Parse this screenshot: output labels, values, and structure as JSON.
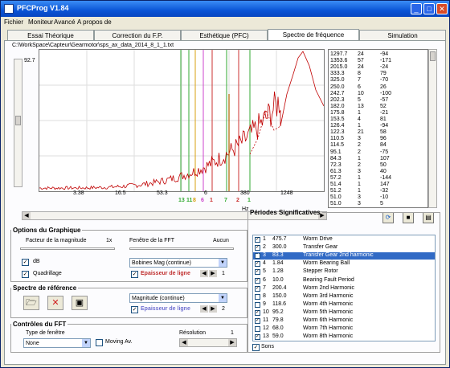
{
  "window": {
    "title": "PFCProg V1.84"
  },
  "menu": [
    "Fichier",
    "Moniteur",
    "Avancé",
    "A propos de"
  ],
  "tabs": [
    {
      "label": "Essai Théorique",
      "active": false
    },
    {
      "label": "Correction du F.P.",
      "active": false
    },
    {
      "label": "Esthétique (PFC)",
      "active": false
    },
    {
      "label": "Spectre de fréquence",
      "active": true
    },
    {
      "label": "Simulation",
      "active": false
    }
  ],
  "chart": {
    "path": "C:\\WorkSpace\\Capteur\\Gearmotor\\sps_ax_data_2014_8_1_1.txt",
    "ytop": "92.7",
    "xticks": [
      "3.38",
      "16.5",
      "53.3",
      "6",
      "380",
      "1248"
    ],
    "xunit": "Hz",
    "markers": [
      {
        "label": "13",
        "color": "#33aa33"
      },
      {
        "label": "11",
        "color": "#33aa33"
      },
      {
        "label": "8",
        "color": "#d8a010"
      },
      {
        "label": "6",
        "color": "#cc44cc"
      },
      {
        "label": "1",
        "color": "#cc3333"
      },
      {
        "label": "7",
        "color": "#33aa33"
      },
      {
        "label": "2",
        "color": "#cc3333"
      },
      {
        "label": "1",
        "color": "#33aa33"
      }
    ]
  },
  "freq_list": [
    [
      "1297.7",
      "24",
      "-94"
    ],
    [
      "1353.6",
      "57",
      "-171"
    ],
    [
      "2015.0",
      "24",
      "-24"
    ],
    [
      "333.3",
      "8",
      "79"
    ],
    [
      "325.0",
      "7",
      "-70"
    ],
    [
      "250.0",
      "6",
      "26"
    ],
    [
      "242.7",
      "10",
      "-100"
    ],
    [
      "202.3",
      "5",
      "-57"
    ],
    [
      "182.0",
      "13",
      "52"
    ],
    [
      "175.8",
      "1",
      "-21"
    ],
    [
      "153.5",
      "4",
      "81"
    ],
    [
      "126.4",
      "1",
      "-94"
    ],
    [
      "122.3",
      "21",
      "58"
    ],
    [
      "110.5",
      "3",
      "96"
    ],
    [
      "114.5",
      "2",
      "84"
    ],
    [
      "95.1",
      "2",
      "-75"
    ],
    [
      "84.3",
      "1",
      "107"
    ],
    [
      "72.3",
      "2",
      "50"
    ],
    [
      "61.3",
      "3",
      "40"
    ],
    [
      "57.2",
      "1",
      "-144"
    ],
    [
      "51.4",
      "1",
      "147"
    ],
    [
      "51.2",
      "1",
      "-32"
    ],
    [
      "51.0",
      "3",
      "-10"
    ],
    [
      "51.0",
      "3",
      "5"
    ]
  ],
  "options": {
    "legend": "Options du Graphique",
    "scale_label": "Facteur de la magnitude",
    "scale_value": "1x",
    "fft_label": "Fenêtre de la FFT",
    "fft_value": "Aucun",
    "db_label": "dB",
    "quadrillage_label": "Quadrillage",
    "db_checked": true,
    "quadrillage_checked": true,
    "plot_combo": "Bobines Mag (continue)",
    "epaisseur_label": "Epaisseur de ligne",
    "epaisseur_value": "1"
  },
  "reference": {
    "legend": "Spectre de référence",
    "combo": "Magnitude (continue)",
    "epaisseur_label": "Epaisseur de ligne",
    "epaisseur_value": "2"
  },
  "fft_controls": {
    "legend": "Contrôles du FFT",
    "type_label": "Type de fenêtre",
    "type_value": "None",
    "moving_avg_label": "Moving Av.",
    "resolution_label": "Résolution",
    "resolution_value": "1"
  },
  "periods": {
    "legend": "Périodes Significatives",
    "rows": [
      {
        "num": "1",
        "val": "475.7",
        "name": "Worm Drive",
        "checked": true,
        "selected": false
      },
      {
        "num": "2",
        "val": "300.0",
        "name": "Transfer Gear",
        "checked": true,
        "selected": false
      },
      {
        "num": "3",
        "val": "83.3",
        "name": "Transfer Gear 2nd harmonic",
        "checked": true,
        "selected": true
      },
      {
        "num": "4",
        "val": "1.84",
        "name": "Worm Bearing Ball",
        "checked": true,
        "selected": false
      },
      {
        "num": "5",
        "val": "1.28",
        "name": "Stepper Rotor",
        "checked": true,
        "selected": false
      },
      {
        "num": "6",
        "val": "10.0",
        "name": "Bearing Fault Period",
        "checked": true,
        "selected": false
      },
      {
        "num": "7",
        "val": "200.4",
        "name": "Worm 2nd Harmonic",
        "checked": true,
        "selected": false
      },
      {
        "num": "8",
        "val": "150.0",
        "name": "Worm 3rd Harmonic",
        "checked": false,
        "selected": false
      },
      {
        "num": "9",
        "val": "118.6",
        "name": "Worm 4th Harmonic",
        "checked": false,
        "selected": false
      },
      {
        "num": "10",
        "val": "95.2",
        "name": "Worm 5th Harmonic",
        "checked": true,
        "selected": false
      },
      {
        "num": "11",
        "val": "79.8",
        "name": "Worm 6th Harmonic",
        "checked": true,
        "selected": false
      },
      {
        "num": "12",
        "val": "68.0",
        "name": "Worm 7th Harmonic",
        "checked": false,
        "selected": false
      },
      {
        "num": "13",
        "val": "59.0",
        "name": "Worm 8th Harmonic",
        "checked": true,
        "selected": false
      }
    ],
    "bottom_label": "Sons"
  }
}
